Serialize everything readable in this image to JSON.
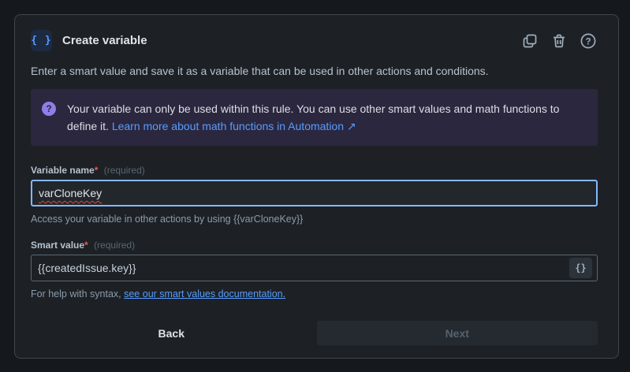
{
  "dialog": {
    "title": "Create variable",
    "header_icon_glyph": "{ }",
    "description": "Enter a smart value and save it as a variable that can be used in other actions and conditions."
  },
  "toolbar": {
    "duplicate_icon": "duplicate-icon",
    "delete_icon": "trash-icon",
    "help_icon": "help-icon"
  },
  "banner": {
    "info_glyph": "?",
    "text": "Your variable can only be used within this rule. You can use other smart values and math functions to define it. ",
    "link_label": "Learn more about math functions in Automation ↗"
  },
  "fields": {
    "variable_name": {
      "label": "Variable name",
      "required_asterisk": "*",
      "required_hint": "(required)",
      "value": "varCloneKey",
      "help": "Access your variable in other actions by using {{varCloneKey}}"
    },
    "smart_value": {
      "label": "Smart value",
      "required_asterisk": "*",
      "required_hint": "(required)",
      "value": "{{createdIssue.key}}",
      "insert_button_glyph": "{}",
      "help_prefix": "For help with syntax, ",
      "help_link": "see our smart values documentation."
    }
  },
  "footer": {
    "back_label": "Back",
    "next_label": "Next"
  },
  "colors": {
    "accent_blue": "#579dff",
    "focus_border": "#85b8ff",
    "banner_bg": "#2b273f",
    "banner_icon_purple": "#8f7ee7",
    "required_red": "#f15b50",
    "panel_bg": "#1d2125",
    "page_bg": "#15191d",
    "spellcheck_red": "#e2483d"
  }
}
